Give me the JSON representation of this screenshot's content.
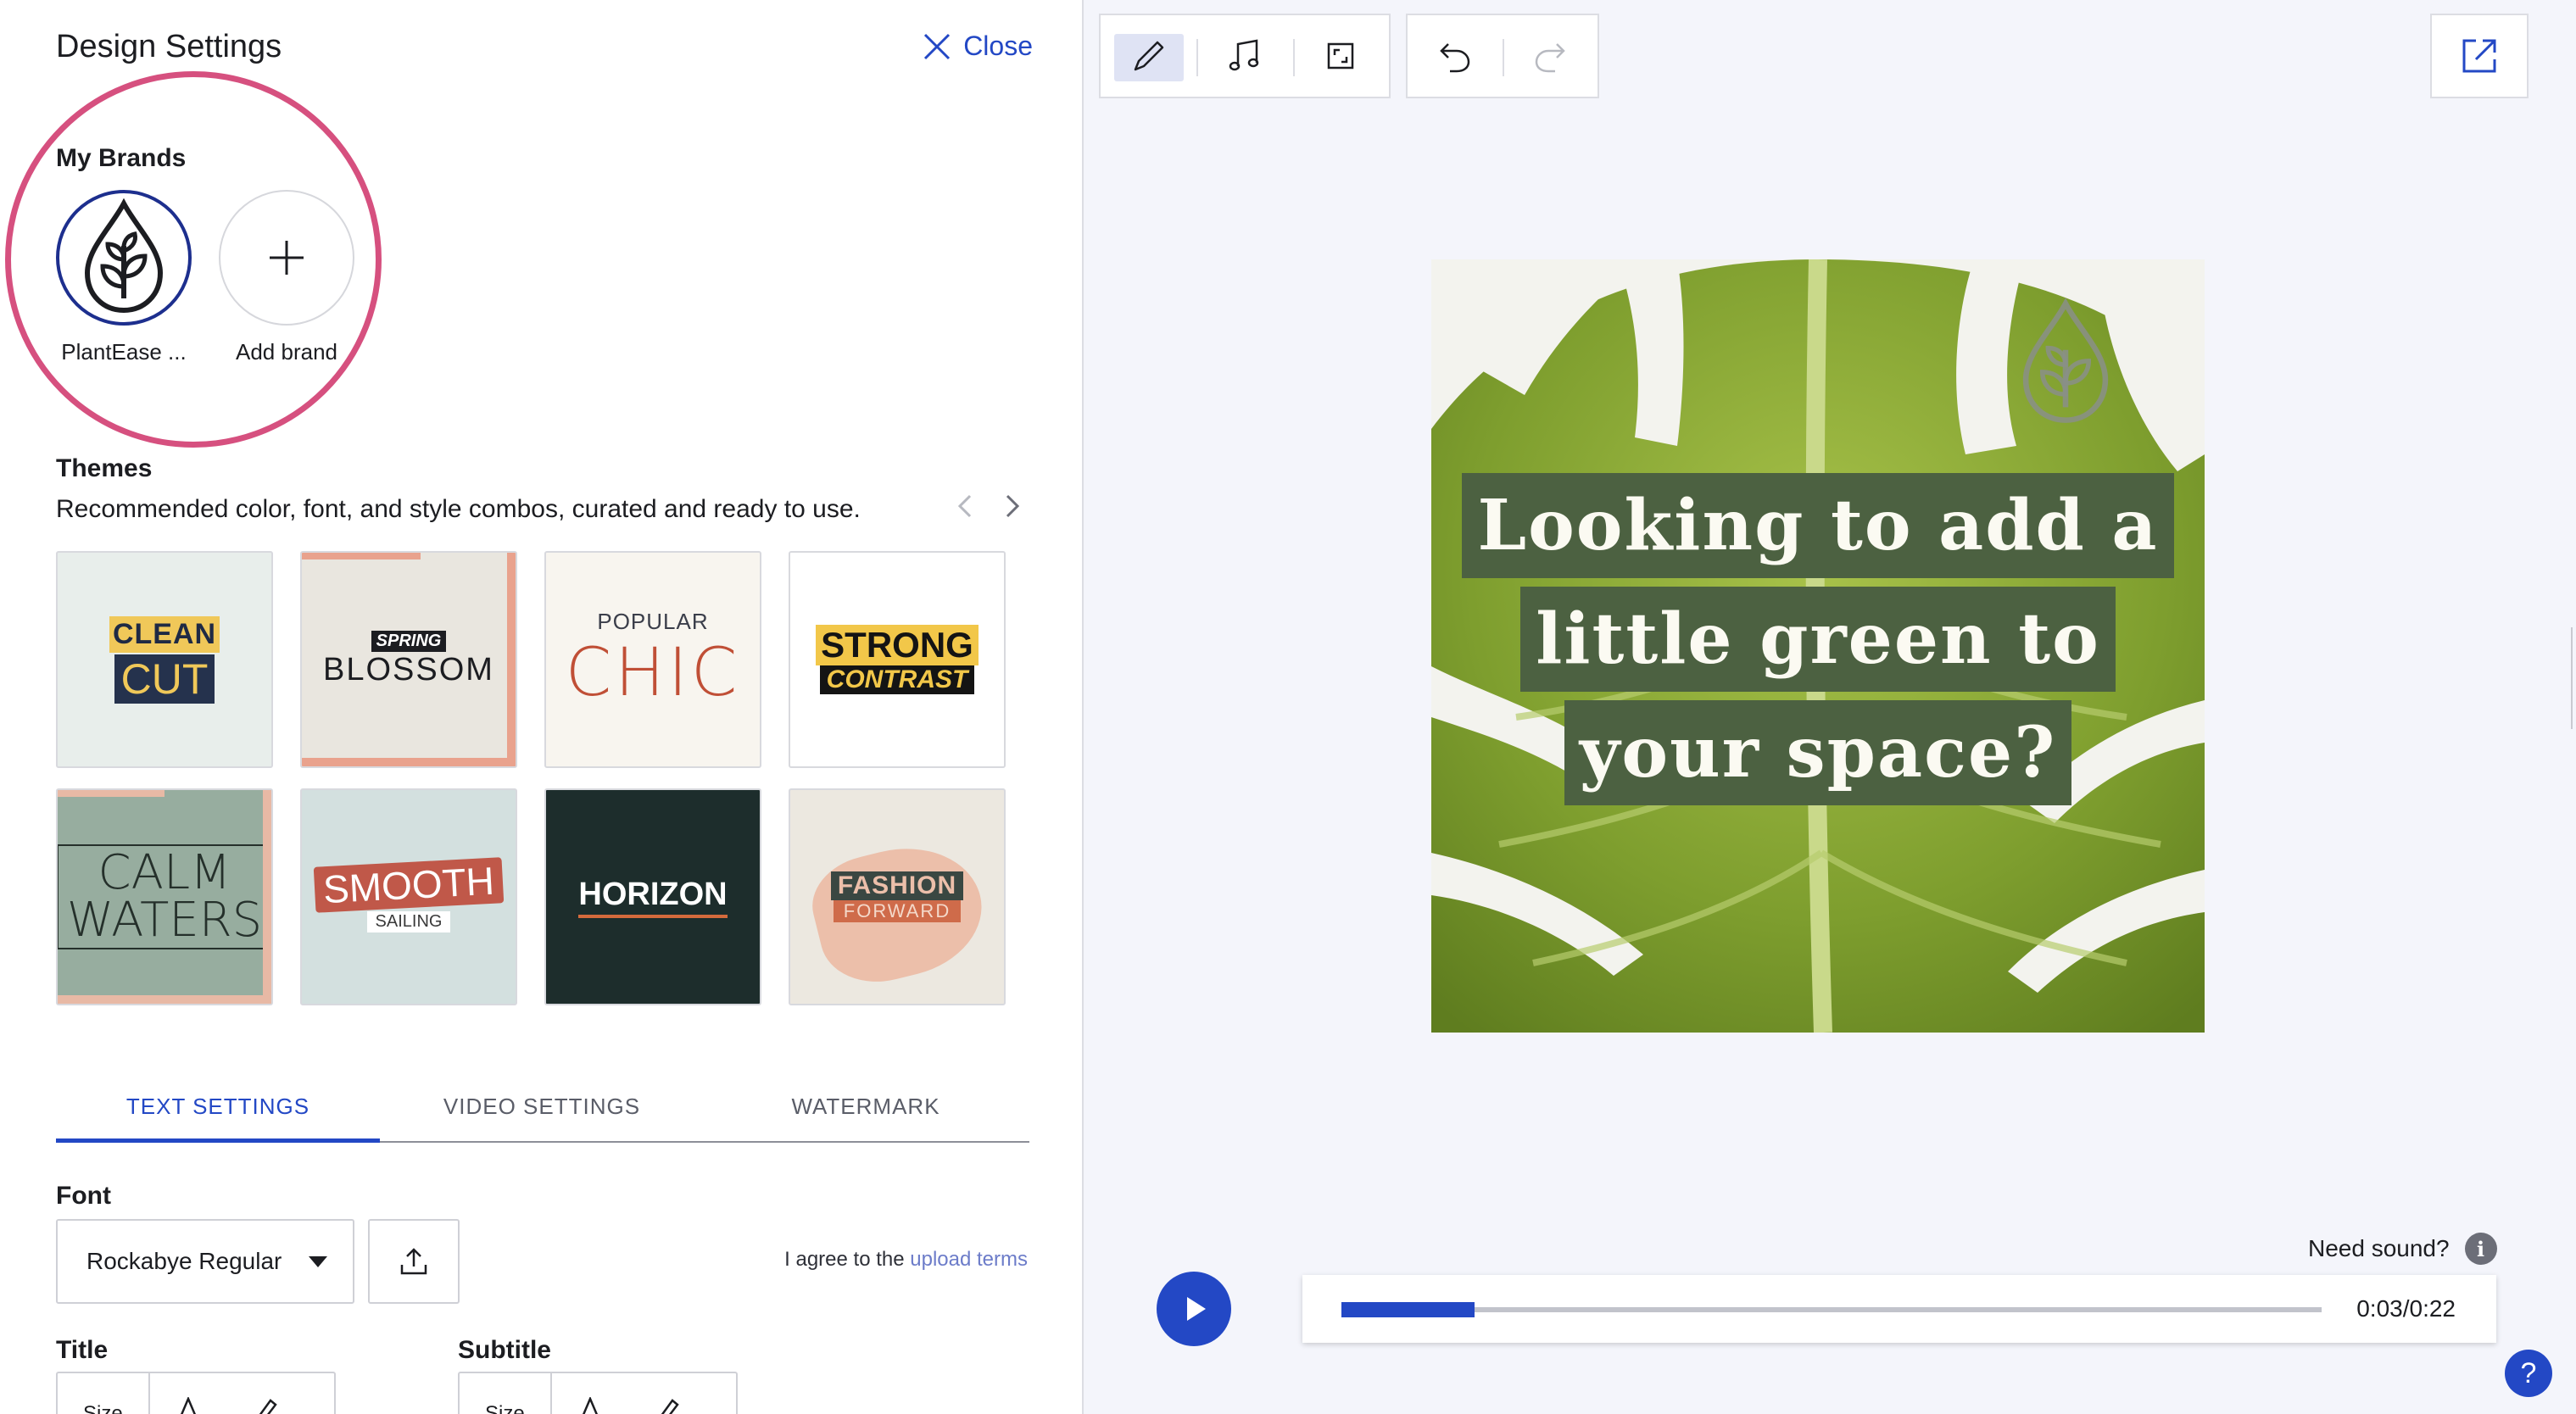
{
  "panel": {
    "title": "Design Settings",
    "close_label": "Close"
  },
  "brands": {
    "label": "My Brands",
    "items": [
      {
        "name": "PlantEase ...",
        "icon": "plant-drop-icon"
      },
      {
        "name": "Add brand",
        "icon": "plus-icon"
      }
    ]
  },
  "themes": {
    "label": "Themes",
    "description": "Recommended color, font, and style combos, curated and ready to use.",
    "items": [
      {
        "line1": "CLEAN",
        "line2": "CUT"
      },
      {
        "line1": "SPRING",
        "line2": "BLOSSOM"
      },
      {
        "line1": "POPULAR",
        "line2": "CHIC"
      },
      {
        "line1": "STRONG",
        "line2": "CONTRAST"
      },
      {
        "line1": "CALM",
        "line2": "WATERS"
      },
      {
        "line1": "SMOOTH",
        "line2": "SAILING"
      },
      {
        "line1": "HORIZON",
        "line2": ""
      },
      {
        "line1": "FASHION",
        "line2": "FORWARD"
      }
    ]
  },
  "tabs": [
    {
      "label": "TEXT SETTINGS",
      "active": true
    },
    {
      "label": "VIDEO SETTINGS",
      "active": false
    },
    {
      "label": "WATERMARK",
      "active": false
    }
  ],
  "text_settings": {
    "font_label": "Font",
    "font_value": "Rockabye Regular",
    "agree_text": "I agree to the",
    "upload_terms_link": "upload terms",
    "title_label": "Title",
    "subtitle_label": "Subtitle",
    "size_label": "Size"
  },
  "canvas": {
    "caption_lines": [
      "Looking to add a",
      "little green to",
      "your space?"
    ]
  },
  "player": {
    "need_sound": "Need sound?",
    "info_glyph": "i",
    "time": "0:03/0:22",
    "progress": 0.136
  },
  "help_glyph": "?",
  "colors": {
    "accent": "#2348c5",
    "highlight_ring": "#d6507f",
    "caption_bg": "#4c6141",
    "leaf_green": "#7b9a2c"
  }
}
